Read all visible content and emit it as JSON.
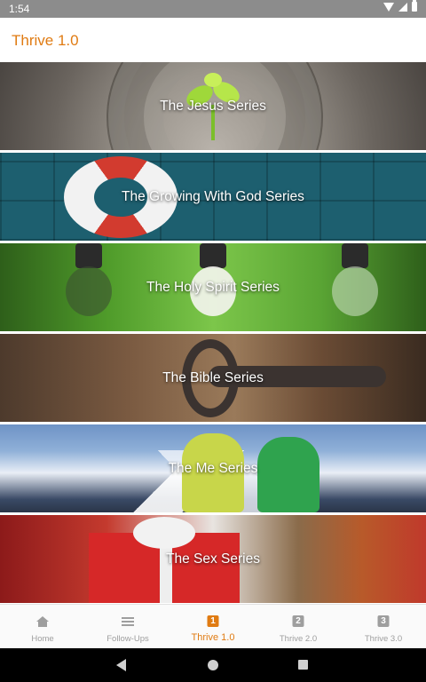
{
  "status_bar": {
    "time": "1:54",
    "icons": [
      "wifi-icon",
      "signal-icon",
      "battery-icon"
    ]
  },
  "app_bar": {
    "title": "Thrive 1.0",
    "accent_color": "#e07b12"
  },
  "series": [
    {
      "label": "The Jesus Series"
    },
    {
      "label": "The Growing With God Series"
    },
    {
      "label": "The Holy Spirit Series"
    },
    {
      "label": "The Bible Series"
    },
    {
      "label": "The Me Series"
    },
    {
      "label": "The Sex Series"
    }
  ],
  "bottom_nav": {
    "items": [
      {
        "label": "Home",
        "icon": "home-icon",
        "active": false
      },
      {
        "label": "Follow-Ups",
        "icon": "list-icon",
        "active": false
      },
      {
        "label": "Thrive 1.0",
        "badge": "1",
        "active": true
      },
      {
        "label": "Thrive 2.0",
        "badge": "2",
        "active": false
      },
      {
        "label": "Thrive 3.0",
        "badge": "3",
        "active": false
      }
    ]
  },
  "system_nav": {
    "icons": [
      "back-icon",
      "home-circle-icon",
      "recents-icon"
    ]
  }
}
